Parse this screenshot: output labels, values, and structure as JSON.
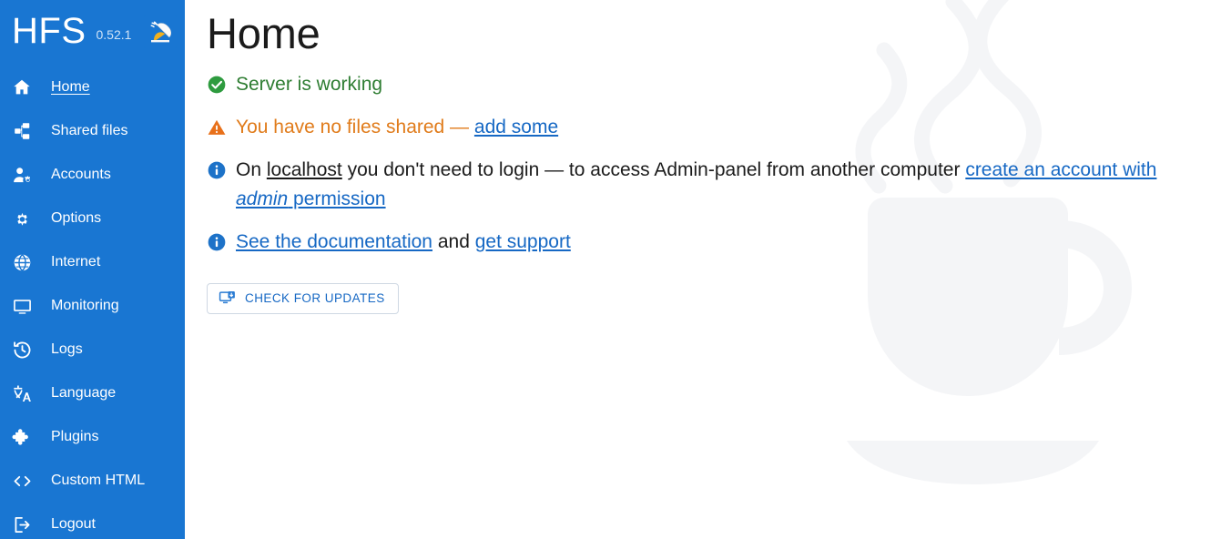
{
  "app": {
    "brand": "HFS",
    "version": "0.52.1",
    "logo_icon": "satellite-dish-icon"
  },
  "sidebar": {
    "background_color": "#1976d2",
    "items": [
      {
        "label": "Home",
        "icon": "home-icon",
        "active": true
      },
      {
        "label": "Shared files",
        "icon": "sitemap-icon",
        "active": false
      },
      {
        "label": "Accounts",
        "icon": "user-gear-icon",
        "active": false
      },
      {
        "label": "Options",
        "icon": "gear-icon",
        "active": false
      },
      {
        "label": "Internet",
        "icon": "globe-icon",
        "active": false
      },
      {
        "label": "Monitoring",
        "icon": "monitor-icon",
        "active": false
      },
      {
        "label": "Logs",
        "icon": "history-icon",
        "active": false
      },
      {
        "label": "Language",
        "icon": "translate-icon",
        "active": false
      },
      {
        "label": "Plugins",
        "icon": "puzzle-icon",
        "active": false
      },
      {
        "label": "Custom HTML",
        "icon": "code-icon",
        "active": false
      },
      {
        "label": "Logout",
        "icon": "logout-icon",
        "active": false
      }
    ]
  },
  "scrollbar": {
    "up_icon": "chevron-up-icon",
    "down_icon": "chevron-down-icon",
    "track_color": "#73a4dd",
    "thumb_color": "#7aa6d8"
  },
  "main": {
    "page_title": "Home",
    "watermark_icon": "coffee-cup-icon",
    "messages": [
      {
        "kind": "ok",
        "icon": "check-circle-icon",
        "color": "#2e7d32",
        "text": "Server is working"
      },
      {
        "kind": "warn",
        "icon": "warning-triangle-icon",
        "color": "#e07b1a",
        "text_before": "You have no files shared — ",
        "link": "add some"
      },
      {
        "kind": "info",
        "icon": "info-circle-icon",
        "color": "#1668c4",
        "seg_1": "On ",
        "seg_localhost": "localhost",
        "seg_2": " you don't need to login — to access Admin-panel from another computer ",
        "link_1": "create an account with ",
        "link_em": "admin",
        "link_2": " permission"
      },
      {
        "kind": "info",
        "icon": "info-circle-icon",
        "color": "#1668c4",
        "link_docs": "See the documentation",
        "seg_and": " and ",
        "link_support": "get support"
      }
    ],
    "check_updates_button": {
      "label": "CHECK FOR UPDATES",
      "icon": "download-to-computer-icon",
      "color": "#1668c4"
    }
  }
}
